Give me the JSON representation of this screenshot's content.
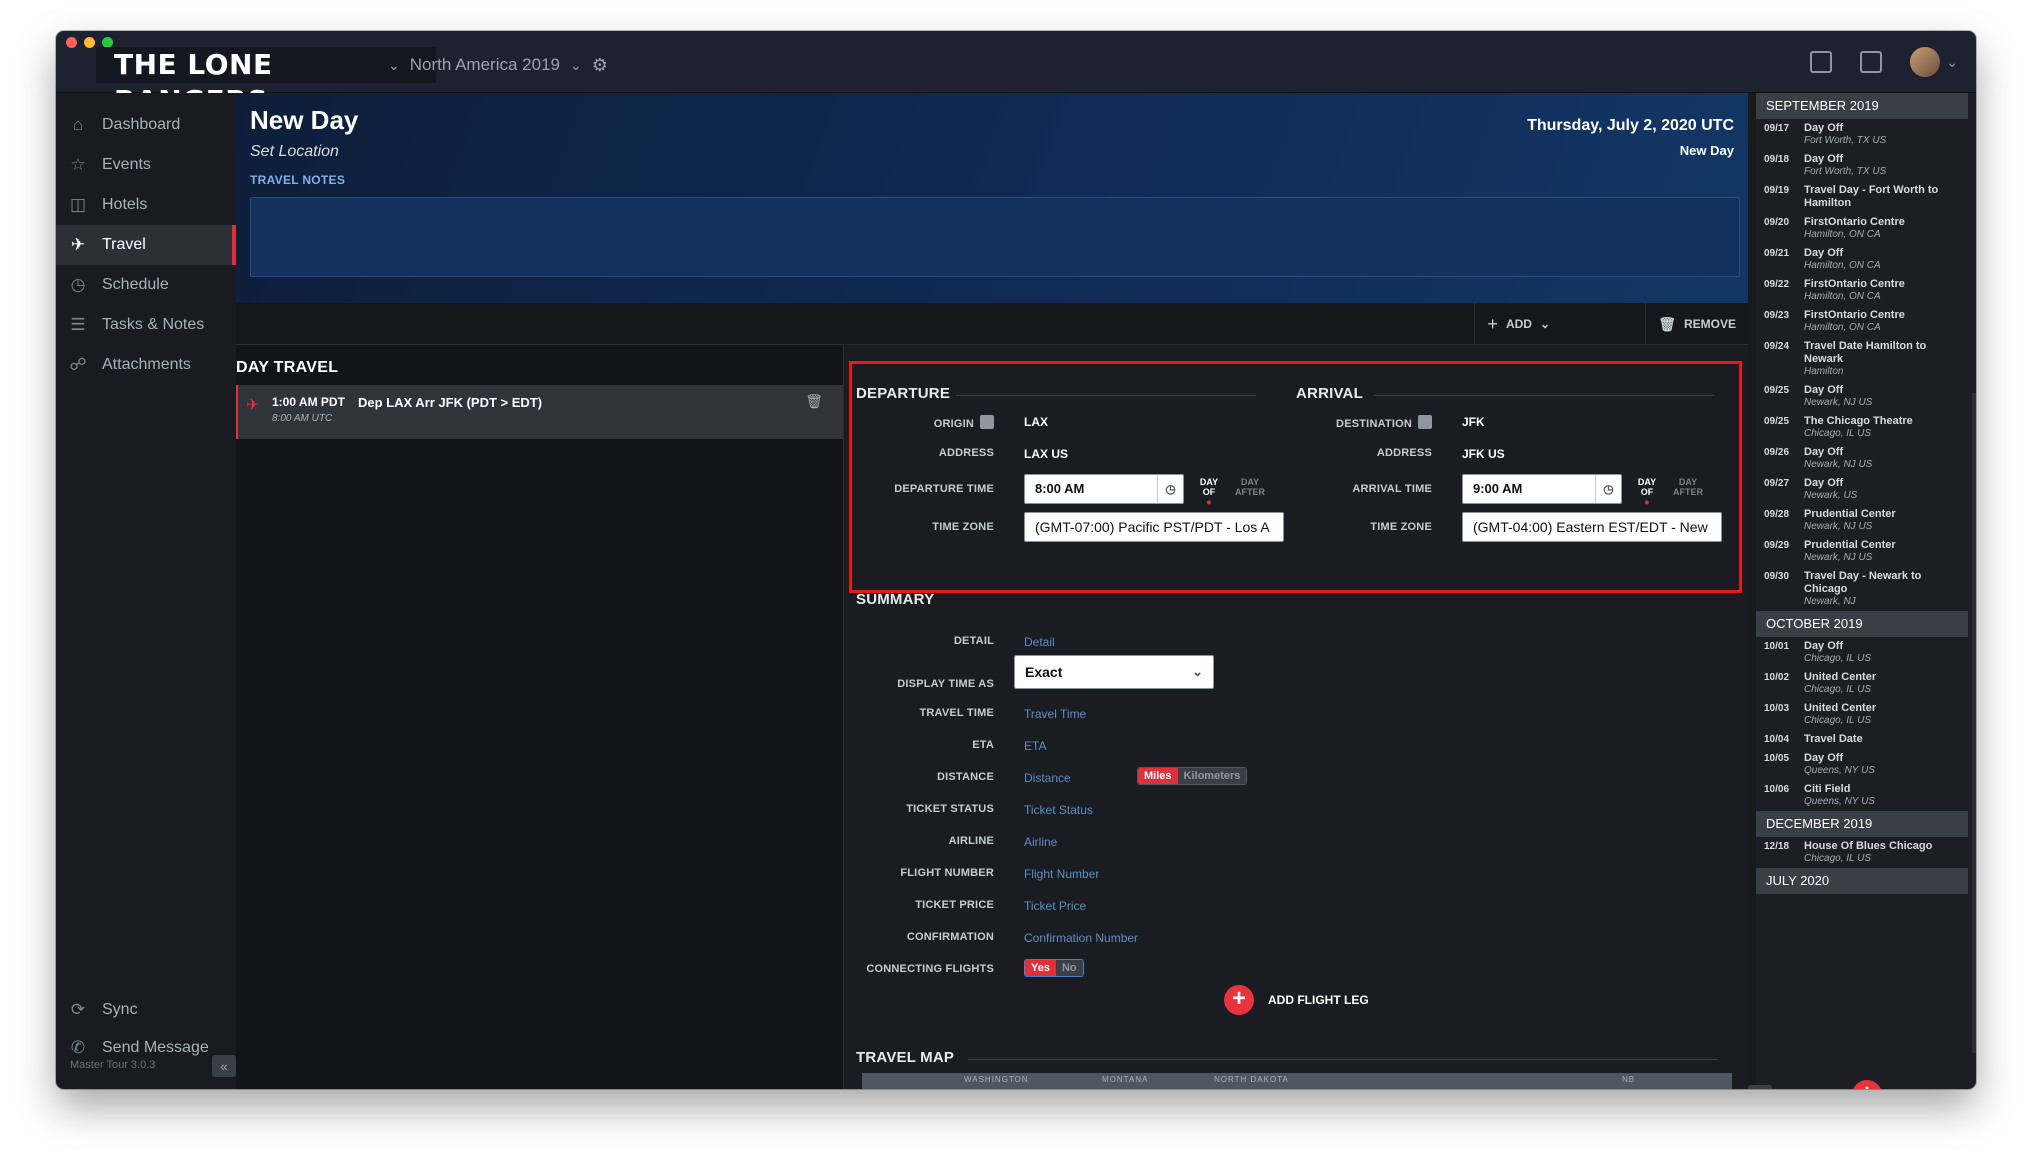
{
  "app": {
    "brand": "THE LONE RANGERS",
    "tour": "North America 2019",
    "version": "Master Tour 3.0.3"
  },
  "sidebar": {
    "items": [
      {
        "label": "Dashboard",
        "icon": "house-icon"
      },
      {
        "label": "Events",
        "icon": "star-icon"
      },
      {
        "label": "Hotels",
        "icon": "building-icon"
      },
      {
        "label": "Travel",
        "icon": "plane-icon"
      },
      {
        "label": "Schedule",
        "icon": "clock-icon"
      },
      {
        "label": "Tasks & Notes",
        "icon": "list-icon"
      },
      {
        "label": "Attachments",
        "icon": "paperclip-icon"
      }
    ],
    "bottom": [
      {
        "label": "Sync",
        "icon": "sync-icon"
      },
      {
        "label": "Send Message",
        "icon": "megaphone-icon"
      }
    ]
  },
  "header": {
    "title": "New Day",
    "subtitle": "Set Location",
    "notes_label": "TRAVEL NOTES",
    "date": "Thursday, July 2, 2020 UTC",
    "day_name": "New Day"
  },
  "toolbar": {
    "add_label": "ADD",
    "remove_label": "REMOVE"
  },
  "day_travel": {
    "title": "DAY TRAVEL",
    "row": {
      "time": "1:00 AM PDT",
      "description": "Dep LAX Arr JFK (PDT > EDT)",
      "utc": "8:00 AM UTC"
    }
  },
  "departure": {
    "title": "DEPARTURE",
    "origin_label": "ORIGIN",
    "origin": "LAX",
    "address_label": "ADDRESS",
    "address": "LAX US",
    "time_label": "DEPARTURE TIME",
    "time": "8:00 AM",
    "dayof": "DAY\nOF",
    "dayafter": "DAY\nAFTER",
    "tz_label": "TIME ZONE",
    "tz": "(GMT-07:00) Pacific PST/PDT - Los A"
  },
  "arrival": {
    "title": "ARRIVAL",
    "dest_label": "DESTINATION",
    "dest": "JFK",
    "address_label": "ADDRESS",
    "address": "JFK US",
    "time_label": "ARRIVAL TIME",
    "time": "9:00 AM",
    "dayof": "DAY\nOF",
    "dayafter": "DAY\nAFTER",
    "tz_label": "TIME ZONE",
    "tz": "(GMT-04:00) Eastern EST/EDT - New"
  },
  "summary": {
    "title": "SUMMARY",
    "detail_label": "DETAIL",
    "detail_ph": "Detail",
    "display_label": "DISPLAY TIME AS",
    "display_value": "Exact",
    "travel_time_label": "TRAVEL TIME",
    "travel_time_ph": "Travel Time",
    "eta_label": "ETA",
    "eta_ph": "ETA",
    "distance_label": "DISTANCE",
    "distance_ph": "Distance",
    "miles": "Miles",
    "km": "Kilometers",
    "ticket_status_label": "TICKET STATUS",
    "ticket_status_ph": "Ticket Status",
    "airline_label": "AIRLINE",
    "airline_ph": "Airline",
    "flight_label": "FLIGHT NUMBER",
    "flight_ph": "Flight Number",
    "price_label": "TICKET PRICE",
    "price_ph": "Ticket Price",
    "confirm_label": "CONFIRMATION",
    "confirm_ph": "Confirmation Number",
    "connecting_label": "CONNECTING FLIGHTS",
    "yes": "Yes",
    "no": "No",
    "add_leg": "ADD FLIGHT LEG"
  },
  "map": {
    "title": "TRAVEL MAP",
    "labels": [
      "WASHINGTON",
      "MONTANA",
      "NORTH DAKOTA",
      "NB"
    ]
  },
  "schedule": [
    {
      "month": "SEPTEMBER 2019",
      "items": [
        {
          "date": "09/17",
          "title": "Day Off",
          "loc": "Fort Worth, TX US"
        },
        {
          "date": "09/18",
          "title": "Day Off",
          "loc": "Fort Worth, TX US"
        },
        {
          "date": "09/19",
          "title": "Travel Day - Fort Worth to Hamilton",
          "loc": ""
        },
        {
          "date": "09/20",
          "title": "FirstOntario Centre",
          "loc": "Hamilton, ON CA"
        },
        {
          "date": "09/21",
          "title": "Day Off",
          "loc": "Hamilton, ON CA"
        },
        {
          "date": "09/22",
          "title": "FirstOntario Centre",
          "loc": "Hamilton, ON CA"
        },
        {
          "date": "09/23",
          "title": "FirstOntario Centre",
          "loc": "Hamilton, ON CA"
        },
        {
          "date": "09/24",
          "title": "Travel Date Hamilton to Newark",
          "loc": "Hamilton"
        },
        {
          "date": "09/25",
          "title": "Day Off",
          "loc": "Newark, NJ US"
        },
        {
          "date": "09/25",
          "title": "The Chicago Theatre",
          "loc": "Chicago, IL US"
        },
        {
          "date": "09/26",
          "title": "Day Off",
          "loc": "Newark, NJ US"
        },
        {
          "date": "09/27",
          "title": "Day Off",
          "loc": "Newark, US"
        },
        {
          "date": "09/28",
          "title": "Prudential Center",
          "loc": "Newark, NJ US"
        },
        {
          "date": "09/29",
          "title": "Prudential Center",
          "loc": "Newark, NJ US"
        },
        {
          "date": "09/30",
          "title": "Travel Day - Newark to Chicago",
          "loc": "Newark, NJ"
        }
      ]
    },
    {
      "month": "OCTOBER 2019",
      "items": [
        {
          "date": "10/01",
          "title": "Day Off",
          "loc": "Chicago, IL US"
        },
        {
          "date": "10/02",
          "title": "United Center",
          "loc": "Chicago, IL US"
        },
        {
          "date": "10/03",
          "title": "United Center",
          "loc": "Chicago, IL US"
        },
        {
          "date": "10/04",
          "title": "Travel Date",
          "loc": ""
        },
        {
          "date": "10/05",
          "title": "Day Off",
          "loc": "Queens, NY US"
        },
        {
          "date": "10/06",
          "title": "Citi Field",
          "loc": "Queens, NY US"
        }
      ]
    },
    {
      "month": "DECEMBER 2019",
      "items": [
        {
          "date": "12/18",
          "title": "House Of Blues Chicago",
          "loc": "Chicago, IL US"
        }
      ]
    },
    {
      "month": "JULY 2020",
      "items": []
    }
  ],
  "colors": {
    "accent": "#e0303a",
    "header_bg": "#0f2a55",
    "highlight_box": "#e41c1c"
  }
}
